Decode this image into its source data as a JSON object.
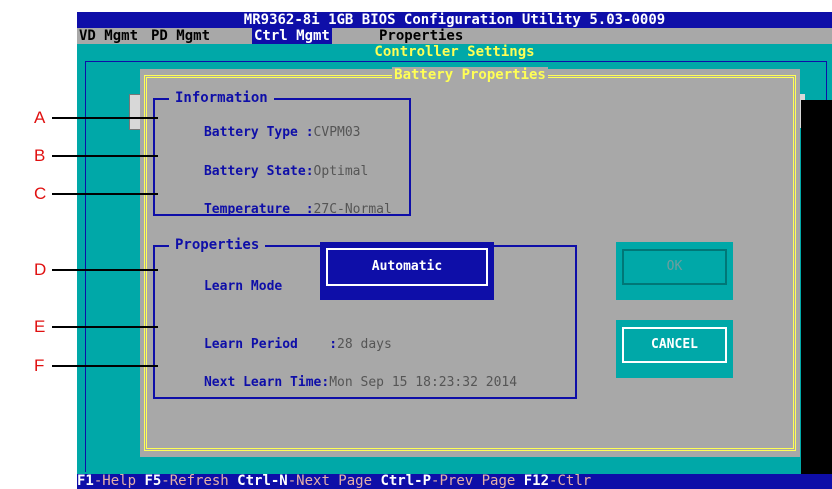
{
  "app_title": "MR9362-8i 1GB BIOS Configuration Utility 5.03-0009",
  "menu": [
    {
      "label": "VD Mgmt"
    },
    {
      "label": "PD Mgmt"
    },
    {
      "label": "Ctrl Mgmt"
    },
    {
      "label": "Properties"
    }
  ],
  "controller_settings_title": "Controller Settings",
  "right_fragment": "y",
  "dialog": {
    "title": "Battery Properties",
    "information": {
      "title": "Information",
      "battery_type_label": "Battery Type :",
      "battery_type_value": "CVPM03",
      "battery_state_label": "Battery State:",
      "battery_state_value": "Optimal",
      "temperature_label": "Temperature  :",
      "temperature_value": "27C-Normal"
    },
    "properties": {
      "title": "Properties",
      "learn_mode_label": "Learn Mode       :",
      "learn_mode_value": "Automatic",
      "learn_period_label": "Learn Period    :",
      "learn_period_value": "28 days",
      "next_learn_label": "Next Learn Time:",
      "next_learn_value": "Mon Sep 15 18:23:32 2014"
    },
    "ok_label": "OK",
    "cancel_label": "CANCEL"
  },
  "status_bar": [
    {
      "key": "F1",
      "desc": "-Help "
    },
    {
      "key": "F5",
      "desc": "-Refresh "
    },
    {
      "key": "Ctrl-N",
      "desc": "-Next Page "
    },
    {
      "key": "Ctrl-P",
      "desc": "-Prev Page "
    },
    {
      "key": "F12",
      "desc": "-Ctlr"
    }
  ],
  "callouts": [
    "A",
    "B",
    "C",
    "D",
    "E",
    "F"
  ]
}
